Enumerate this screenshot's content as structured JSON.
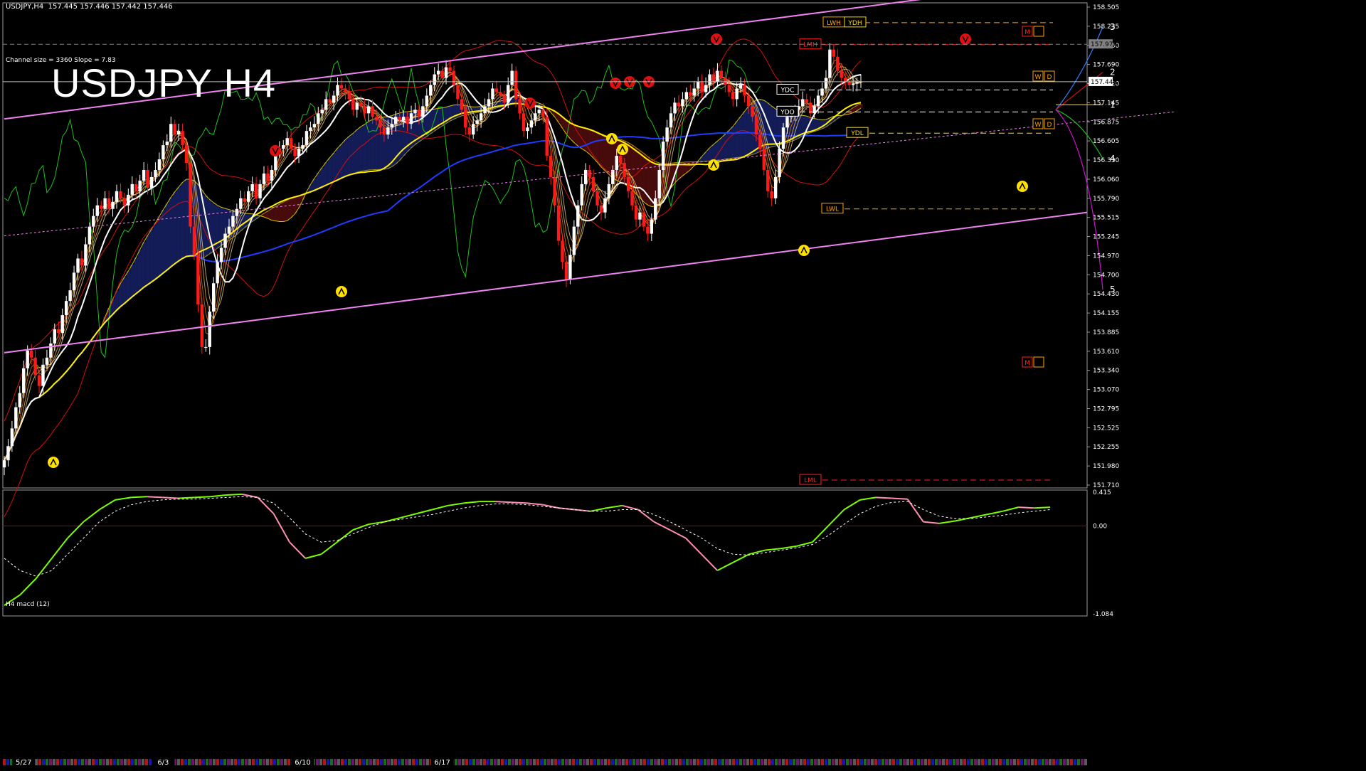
{
  "window": {
    "symbol_header": "USDJPY,H4",
    "ohlc": [
      "157.445",
      "157.446",
      "157.442",
      "157.446"
    ],
    "channel_info": "Channel size = 3360 Slope = 7.83",
    "overlay_title": "USDJPY H4",
    "macd_label": "H4  macd (12)"
  },
  "colors": {
    "background": "#000000",
    "bull_candle": "#ffffff",
    "bear_candle": "#ff1a1a",
    "channel": "#ee82ee",
    "ma_white": "#ffffff",
    "ma_yellow": "#ffee00",
    "ma_blue": "#1f3cff",
    "cloud_bull": "#2b3fbf",
    "cloud_bear": "#a01818",
    "macd_up": "#7cfc00",
    "macd_down": "#ff8fb0",
    "macd_signal": "#ffffff",
    "zero_line": "#a00000",
    "price_line": "#c0c0c0"
  },
  "chart_data": {
    "type": "candlestick",
    "symbol": "USDJPY",
    "timeframe": "H4",
    "ylim": [
      151.71,
      158.56
    ],
    "price_ticks": [
      "158.505",
      "158.235",
      "157.960",
      "157.690",
      "157.420",
      "157.145",
      "156.875",
      "156.605",
      "156.330",
      "156.060",
      "155.790",
      "155.515",
      "155.245",
      "154.970",
      "154.700",
      "154.430",
      "154.155",
      "153.885",
      "153.610",
      "153.340",
      "153.070",
      "152.795",
      "152.525",
      "152.255",
      "151.980",
      "151.710"
    ],
    "current_price": "157.446",
    "highlight_price": "157.975",
    "date_labels": [
      {
        "label": "5/27",
        "index": 5
      },
      {
        "label": "6/3",
        "index": 41
      },
      {
        "label": "6/10",
        "index": 77
      },
      {
        "label": "6/17",
        "index": 113
      }
    ],
    "candles": {
      "count": 222,
      "close": [
        152.1,
        152.3,
        152.55,
        152.85,
        153.05,
        153.4,
        153.65,
        153.55,
        153.3,
        153.15,
        153.45,
        153.55,
        153.75,
        153.95,
        153.9,
        154.15,
        154.35,
        154.5,
        154.75,
        154.95,
        154.85,
        155.15,
        155.4,
        155.55,
        155.7,
        155.65,
        155.8,
        155.65,
        155.75,
        155.9,
        155.8,
        155.7,
        155.85,
        156.0,
        155.9,
        156.05,
        156.2,
        155.95,
        156.1,
        156.2,
        156.35,
        156.55,
        156.6,
        156.85,
        156.7,
        156.75,
        156.55,
        156.3,
        155.4,
        155.0,
        154.3,
        153.7,
        153.7,
        154.2,
        154.6,
        154.9,
        155.1,
        155.3,
        155.4,
        155.55,
        155.65,
        155.8,
        155.75,
        155.9,
        156.0,
        155.8,
        156.0,
        156.15,
        156.05,
        156.2,
        156.45,
        156.5,
        156.55,
        156.65,
        156.5,
        156.4,
        156.5,
        156.55,
        156.75,
        156.8,
        156.85,
        157.0,
        157.05,
        157.2,
        157.15,
        157.25,
        157.4,
        157.35,
        157.3,
        157.2,
        157.05,
        157.15,
        157.1,
        157.0,
        157.1,
        156.95,
        156.9,
        156.8,
        156.7,
        156.8,
        156.85,
        156.95,
        156.9,
        156.95,
        156.85,
        157.0,
        157.05,
        156.95,
        157.1,
        157.25,
        157.4,
        157.55,
        157.6,
        157.5,
        157.65,
        157.6,
        157.4,
        157.2,
        157.05,
        156.8,
        156.7,
        156.85,
        156.9,
        157.0,
        157.1,
        157.2,
        157.35,
        157.3,
        157.25,
        157.15,
        157.4,
        157.6,
        157.2,
        157.0,
        156.75,
        156.8,
        156.9,
        157.0,
        157.05,
        156.95,
        156.4,
        156.1,
        155.7,
        155.2,
        154.9,
        154.65,
        155.0,
        155.4,
        155.7,
        156.0,
        156.2,
        156.1,
        155.9,
        155.7,
        155.6,
        155.8,
        156.0,
        156.2,
        156.4,
        156.3,
        156.1,
        155.9,
        155.7,
        155.5,
        155.6,
        155.4,
        155.3,
        155.5,
        155.8,
        156.2,
        156.6,
        156.8,
        157.0,
        157.15,
        157.1,
        157.2,
        157.3,
        157.25,
        157.35,
        157.45,
        157.3,
        157.4,
        157.55,
        157.45,
        157.6,
        157.5,
        157.4,
        157.3,
        157.2,
        157.35,
        157.4,
        157.25,
        157.1,
        156.95,
        156.7,
        156.5,
        156.2,
        155.9,
        155.8,
        156.1,
        156.5,
        156.8,
        156.95,
        157.0,
        157.05,
        157.1,
        157.2,
        157.15,
        157.0,
        157.1,
        157.25,
        157.35,
        157.5,
        157.9,
        157.8,
        157.6,
        157.5,
        157.45,
        157.4,
        157.42,
        157.44,
        157.446
      ]
    },
    "channel": {
      "upper": [
        [
          0,
          156.92
        ],
        [
          222,
          158.62
        ]
      ],
      "lower": [
        [
          0,
          153.62
        ],
        [
          222,
          155.3
        ]
      ],
      "mid": [
        [
          0,
          155.27
        ],
        [
          222,
          156.96
        ]
      ]
    },
    "levels": [
      {
        "label": "LWH",
        "price": 158.28
      },
      {
        "label": "YDH",
        "price": 158.28
      },
      {
        "label": "LMH",
        "price": 157.97
      },
      {
        "label": "YDC",
        "price": 157.33
      },
      {
        "label": "YDO",
        "price": 157.02
      },
      {
        "label": "YDL",
        "price": 156.72
      },
      {
        "label": "LWL",
        "price": 155.65
      },
      {
        "label": "LML",
        "price": 151.82
      }
    ],
    "projection_labels": [
      {
        "label": "3",
        "price": 158.22
      },
      {
        "label": "2",
        "price": 157.58
      },
      {
        "label": "1",
        "price": 157.12
      },
      {
        "label": "4",
        "price": 156.36
      },
      {
        "label": "5",
        "price": 154.51
      }
    ],
    "period_markers": [
      "M",
      "W",
      "D"
    ],
    "macd": {
      "ylim": [
        -1.084,
        0.415
      ],
      "ticks": [
        "0.415",
        "0.00",
        "-1.084"
      ],
      "values": [
        -0.98,
        -0.85,
        -0.65,
        -0.4,
        -0.15,
        0.05,
        0.2,
        0.32,
        0.35,
        0.36,
        0.35,
        0.34,
        0.35,
        0.36,
        0.38,
        0.39,
        0.35,
        0.15,
        -0.2,
        -0.4,
        -0.35,
        -0.2,
        -0.05,
        0.02,
        0.05,
        0.1,
        0.15,
        0.2,
        0.25,
        0.28,
        0.3,
        0.3,
        0.29,
        0.28,
        0.26,
        0.22,
        0.2,
        0.18,
        0.22,
        0.25,
        0.2,
        0.05,
        -0.05,
        -0.15,
        -0.35,
        -0.55,
        -0.45,
        -0.35,
        -0.3,
        -0.28,
        -0.25,
        -0.2,
        0.0,
        0.2,
        0.32,
        0.35,
        0.34,
        0.33,
        0.05,
        0.03,
        0.06,
        0.1,
        0.14,
        0.18,
        0.23,
        0.22,
        0.23
      ],
      "signal": [
        -0.4,
        -0.55,
        -0.62,
        -0.55,
        -0.35,
        -0.15,
        0.05,
        0.18,
        0.26,
        0.3,
        0.32,
        0.33,
        0.33,
        0.34,
        0.35,
        0.36,
        0.35,
        0.28,
        0.1,
        -0.1,
        -0.2,
        -0.18,
        -0.1,
        -0.02,
        0.05,
        0.08,
        0.11,
        0.14,
        0.18,
        0.22,
        0.25,
        0.27,
        0.27,
        0.26,
        0.24,
        0.22,
        0.2,
        0.18,
        0.18,
        0.2,
        0.2,
        0.14,
        0.05,
        -0.05,
        -0.15,
        -0.28,
        -0.35,
        -0.36,
        -0.33,
        -0.3,
        -0.27,
        -0.23,
        -0.12,
        0.02,
        0.15,
        0.24,
        0.29,
        0.3,
        0.2,
        0.12,
        0.09,
        0.09,
        0.11,
        0.13,
        0.16,
        0.18,
        0.2
      ]
    }
  }
}
